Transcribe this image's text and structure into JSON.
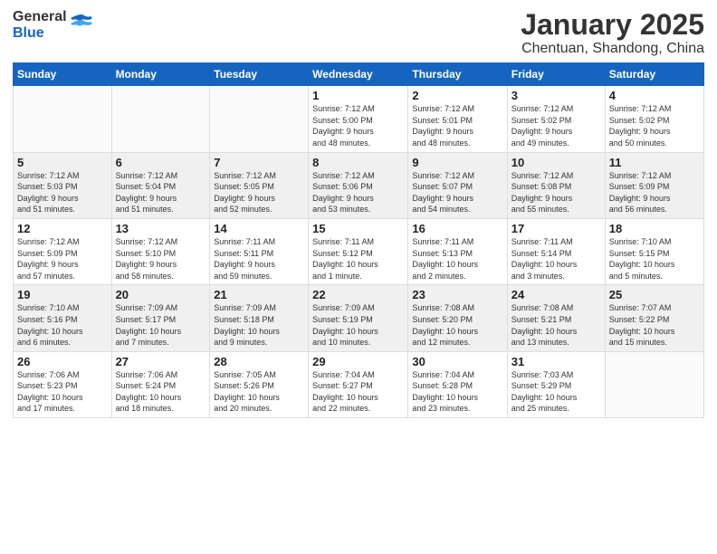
{
  "header": {
    "logo_general": "General",
    "logo_blue": "Blue",
    "month_title": "January 2025",
    "location": "Chentuan, Shandong, China"
  },
  "weekdays": [
    "Sunday",
    "Monday",
    "Tuesday",
    "Wednesday",
    "Thursday",
    "Friday",
    "Saturday"
  ],
  "weeks": [
    [
      {
        "day": "",
        "info": ""
      },
      {
        "day": "",
        "info": ""
      },
      {
        "day": "",
        "info": ""
      },
      {
        "day": "1",
        "info": "Sunrise: 7:12 AM\nSunset: 5:00 PM\nDaylight: 9 hours\nand 48 minutes."
      },
      {
        "day": "2",
        "info": "Sunrise: 7:12 AM\nSunset: 5:01 PM\nDaylight: 9 hours\nand 48 minutes."
      },
      {
        "day": "3",
        "info": "Sunrise: 7:12 AM\nSunset: 5:02 PM\nDaylight: 9 hours\nand 49 minutes."
      },
      {
        "day": "4",
        "info": "Sunrise: 7:12 AM\nSunset: 5:02 PM\nDaylight: 9 hours\nand 50 minutes."
      }
    ],
    [
      {
        "day": "5",
        "info": "Sunrise: 7:12 AM\nSunset: 5:03 PM\nDaylight: 9 hours\nand 51 minutes."
      },
      {
        "day": "6",
        "info": "Sunrise: 7:12 AM\nSunset: 5:04 PM\nDaylight: 9 hours\nand 51 minutes."
      },
      {
        "day": "7",
        "info": "Sunrise: 7:12 AM\nSunset: 5:05 PM\nDaylight: 9 hours\nand 52 minutes."
      },
      {
        "day": "8",
        "info": "Sunrise: 7:12 AM\nSunset: 5:06 PM\nDaylight: 9 hours\nand 53 minutes."
      },
      {
        "day": "9",
        "info": "Sunrise: 7:12 AM\nSunset: 5:07 PM\nDaylight: 9 hours\nand 54 minutes."
      },
      {
        "day": "10",
        "info": "Sunrise: 7:12 AM\nSunset: 5:08 PM\nDaylight: 9 hours\nand 55 minutes."
      },
      {
        "day": "11",
        "info": "Sunrise: 7:12 AM\nSunset: 5:09 PM\nDaylight: 9 hours\nand 56 minutes."
      }
    ],
    [
      {
        "day": "12",
        "info": "Sunrise: 7:12 AM\nSunset: 5:09 PM\nDaylight: 9 hours\nand 57 minutes."
      },
      {
        "day": "13",
        "info": "Sunrise: 7:12 AM\nSunset: 5:10 PM\nDaylight: 9 hours\nand 58 minutes."
      },
      {
        "day": "14",
        "info": "Sunrise: 7:11 AM\nSunset: 5:11 PM\nDaylight: 9 hours\nand 59 minutes."
      },
      {
        "day": "15",
        "info": "Sunrise: 7:11 AM\nSunset: 5:12 PM\nDaylight: 10 hours\nand 1 minute."
      },
      {
        "day": "16",
        "info": "Sunrise: 7:11 AM\nSunset: 5:13 PM\nDaylight: 10 hours\nand 2 minutes."
      },
      {
        "day": "17",
        "info": "Sunrise: 7:11 AM\nSunset: 5:14 PM\nDaylight: 10 hours\nand 3 minutes."
      },
      {
        "day": "18",
        "info": "Sunrise: 7:10 AM\nSunset: 5:15 PM\nDaylight: 10 hours\nand 5 minutes."
      }
    ],
    [
      {
        "day": "19",
        "info": "Sunrise: 7:10 AM\nSunset: 5:16 PM\nDaylight: 10 hours\nand 6 minutes."
      },
      {
        "day": "20",
        "info": "Sunrise: 7:09 AM\nSunset: 5:17 PM\nDaylight: 10 hours\nand 7 minutes."
      },
      {
        "day": "21",
        "info": "Sunrise: 7:09 AM\nSunset: 5:18 PM\nDaylight: 10 hours\nand 9 minutes."
      },
      {
        "day": "22",
        "info": "Sunrise: 7:09 AM\nSunset: 5:19 PM\nDaylight: 10 hours\nand 10 minutes."
      },
      {
        "day": "23",
        "info": "Sunrise: 7:08 AM\nSunset: 5:20 PM\nDaylight: 10 hours\nand 12 minutes."
      },
      {
        "day": "24",
        "info": "Sunrise: 7:08 AM\nSunset: 5:21 PM\nDaylight: 10 hours\nand 13 minutes."
      },
      {
        "day": "25",
        "info": "Sunrise: 7:07 AM\nSunset: 5:22 PM\nDaylight: 10 hours\nand 15 minutes."
      }
    ],
    [
      {
        "day": "26",
        "info": "Sunrise: 7:06 AM\nSunset: 5:23 PM\nDaylight: 10 hours\nand 17 minutes."
      },
      {
        "day": "27",
        "info": "Sunrise: 7:06 AM\nSunset: 5:24 PM\nDaylight: 10 hours\nand 18 minutes."
      },
      {
        "day": "28",
        "info": "Sunrise: 7:05 AM\nSunset: 5:26 PM\nDaylight: 10 hours\nand 20 minutes."
      },
      {
        "day": "29",
        "info": "Sunrise: 7:04 AM\nSunset: 5:27 PM\nDaylight: 10 hours\nand 22 minutes."
      },
      {
        "day": "30",
        "info": "Sunrise: 7:04 AM\nSunset: 5:28 PM\nDaylight: 10 hours\nand 23 minutes."
      },
      {
        "day": "31",
        "info": "Sunrise: 7:03 AM\nSunset: 5:29 PM\nDaylight: 10 hours\nand 25 minutes."
      },
      {
        "day": "",
        "info": ""
      }
    ]
  ]
}
